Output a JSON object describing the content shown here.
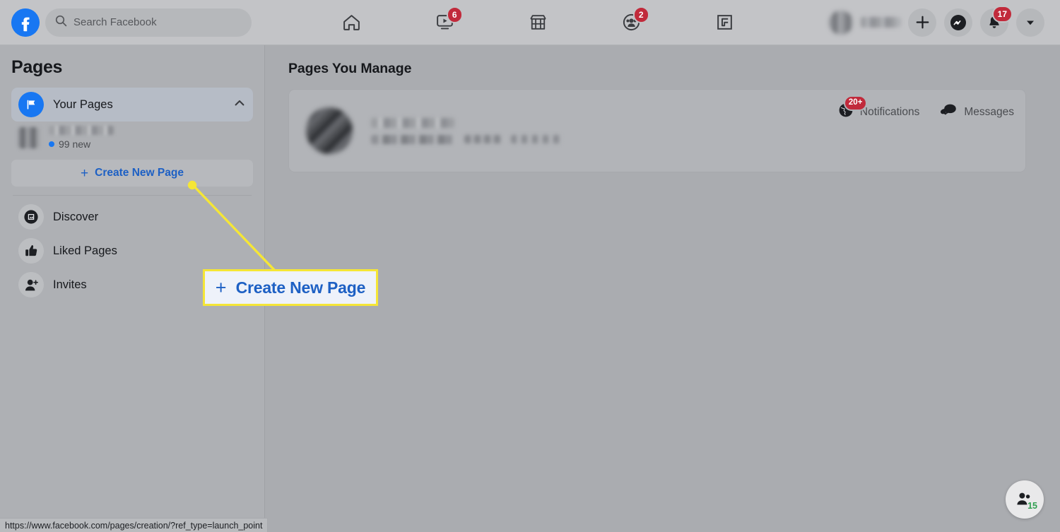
{
  "header": {
    "logo_icon": "facebook-logo-icon",
    "search": {
      "icon": "search-icon",
      "placeholder": "Search Facebook",
      "value": ""
    },
    "nav_items": [
      {
        "name": "home",
        "icon": "home-icon",
        "badge": ""
      },
      {
        "name": "watch",
        "icon": "video-play-icon",
        "badge": "6"
      },
      {
        "name": "marketplace",
        "icon": "storefront-icon",
        "badge": ""
      },
      {
        "name": "groups",
        "icon": "groups-icon",
        "badge": "2"
      },
      {
        "name": "gaming",
        "icon": "gaming-icon",
        "badge": ""
      }
    ],
    "account": {
      "profile_name_redacted": "",
      "create_button_icon": "plus-icon",
      "messenger_icon": "messenger-icon",
      "notifications_icon": "bell-icon",
      "notifications_badge": "17",
      "account_menu_icon": "chevron-down-icon"
    }
  },
  "sidebar": {
    "title": "Pages",
    "your_pages": {
      "icon": "flag-icon",
      "label": "Your Pages",
      "collapse_icon": "chevron-up-icon"
    },
    "managed_page": {
      "name_redacted": "",
      "new_count_label": "99 new"
    },
    "create_new_page": {
      "plus": "+",
      "label": "Create New Page"
    },
    "items": [
      {
        "label": "Discover",
        "icon": "discover-icon"
      },
      {
        "label": "Liked Pages",
        "icon": "thumbs-up-icon"
      },
      {
        "label": "Invites",
        "icon": "person-add-icon"
      }
    ]
  },
  "main": {
    "heading": "Pages You Manage",
    "page_card": {
      "avatar_redacted": "",
      "name_redacted": "",
      "meta_redacted": "",
      "actions": [
        {
          "label": "Notifications",
          "icon": "globe-icon",
          "badge": "20+"
        },
        {
          "label": "Messages",
          "icon": "chat-bubbles-icon",
          "badge": ""
        }
      ]
    }
  },
  "annotation": {
    "callout": {
      "plus": "+",
      "label": "Create New Page"
    },
    "pointer_color": "#f5e636"
  },
  "status_bar": {
    "url": "https://www.facebook.com/pages/creation/?ref_type=launch_point"
  },
  "contacts_widget": {
    "icon": "contacts-icon",
    "count": "15"
  },
  "colors": {
    "brand_blue": "#1877f2",
    "link_blue": "#1d60c4",
    "badge_red": "#c12a3b",
    "highlight_yellow": "#f5e636",
    "page_bg": "#aaacb0",
    "online_green": "#2e9e4f"
  }
}
